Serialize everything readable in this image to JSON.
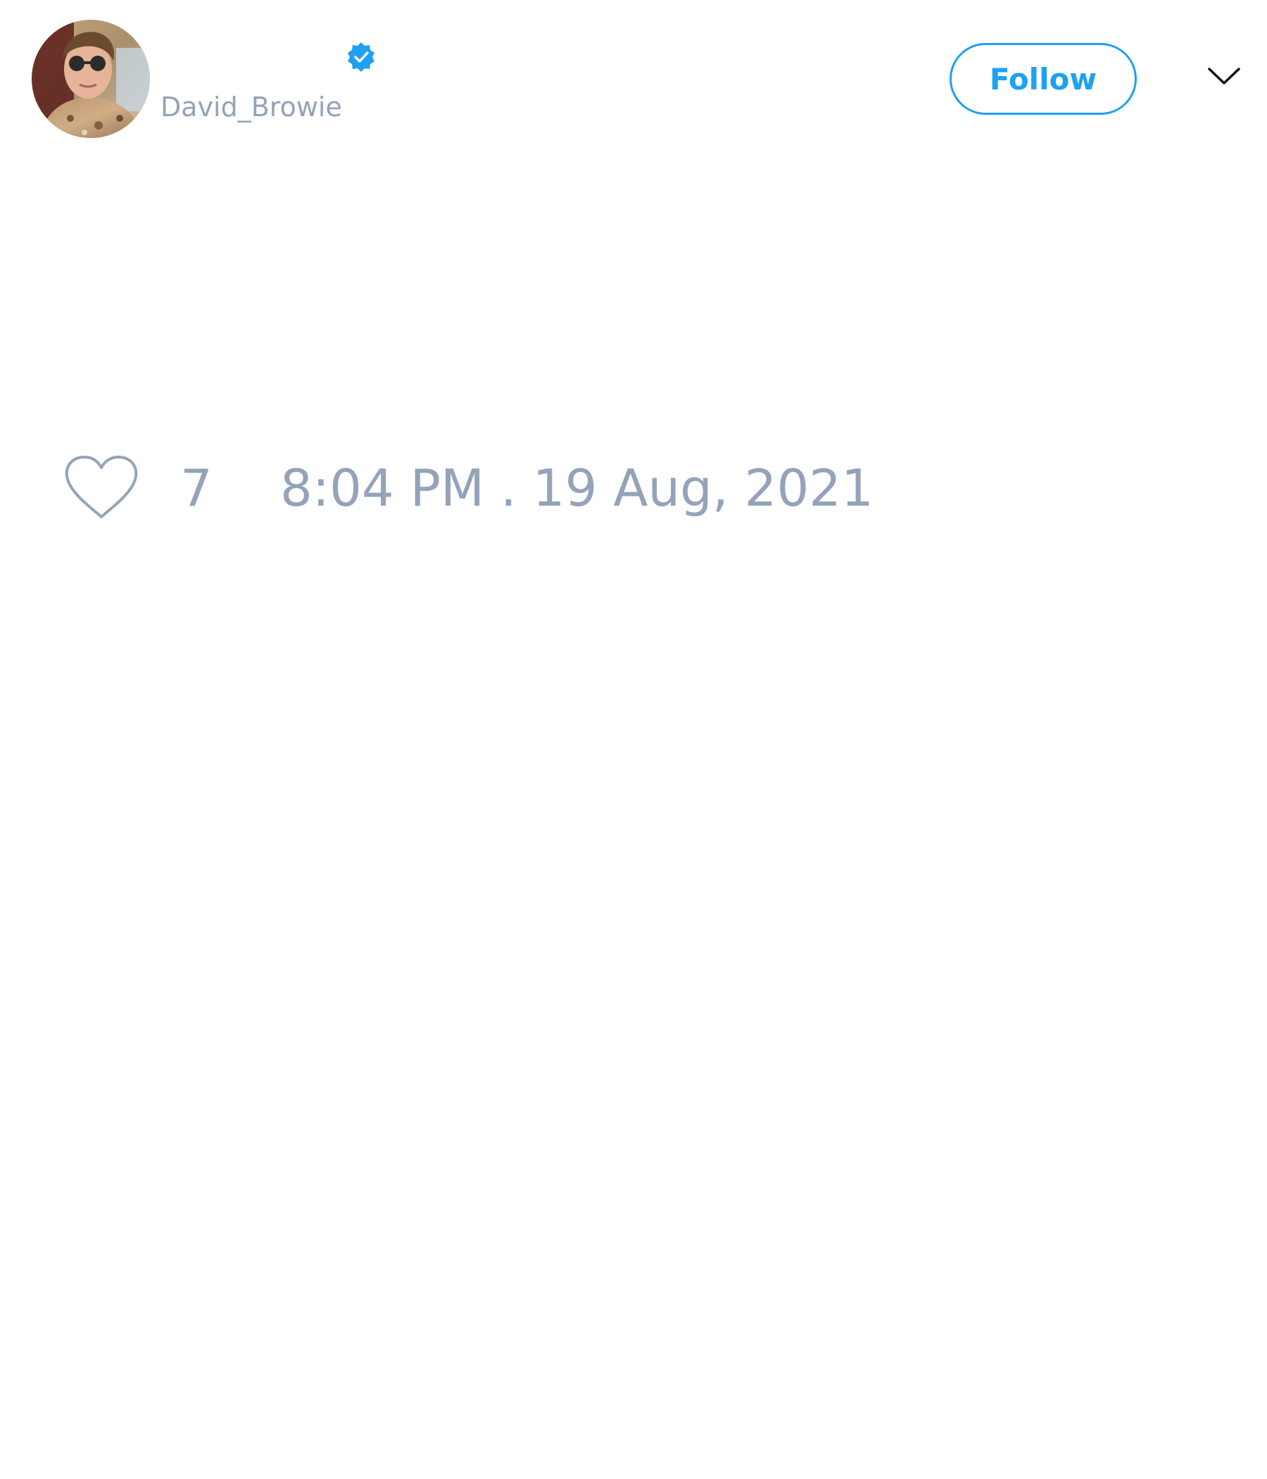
{
  "tweet": {
    "author": {
      "handle": "David_Browie",
      "verified": true,
      "avatar": "profile-photo"
    },
    "follow_label": "Follow",
    "likes": "7",
    "timestamp": "8:04 PM . 19 Aug, 2021"
  },
  "icons": {
    "verified": "verified-badge-icon",
    "more": "chevron-down-icon",
    "like": "heart-icon"
  },
  "colors": {
    "accent": "#1da1f2",
    "muted_text": "#94a3b8",
    "background": "#ffffff"
  }
}
